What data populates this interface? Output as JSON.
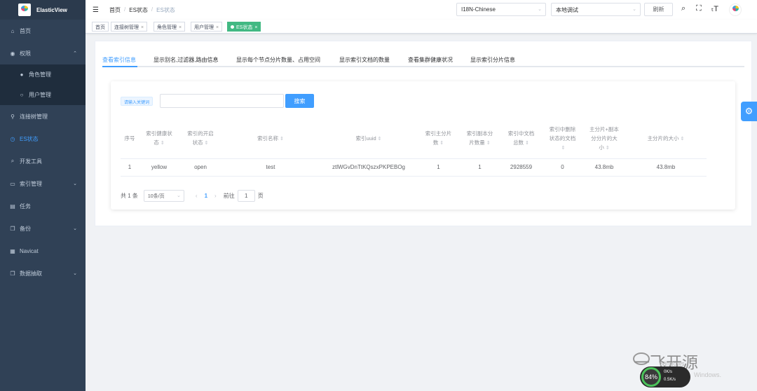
{
  "app": {
    "title": "ElasticView"
  },
  "sidebar": {
    "items": [
      {
        "label": "首页",
        "icon": "home-icon",
        "glyph": "⌂"
      },
      {
        "label": "权限",
        "icon": "user-icon",
        "glyph": "◉",
        "expanded": true
      },
      {
        "label": "角色管理",
        "icon": "user-filled-icon",
        "glyph": "●",
        "sub": true
      },
      {
        "label": "用户管理",
        "icon": "user-outline-icon",
        "glyph": "○",
        "sub": true
      },
      {
        "label": "连接树管理",
        "icon": "link-icon",
        "glyph": "⚲"
      },
      {
        "label": "ES状态",
        "icon": "clock-icon",
        "glyph": "◷",
        "active": true
      },
      {
        "label": "开发工具",
        "icon": "search-icon",
        "glyph": "⌕"
      },
      {
        "label": "索引管理",
        "icon": "disk-icon",
        "glyph": "▭"
      },
      {
        "label": "任务",
        "icon": "document-icon",
        "glyph": "▤"
      },
      {
        "label": "备份",
        "icon": "copy-icon",
        "glyph": "❐"
      },
      {
        "label": "Navicat",
        "icon": "table-icon",
        "glyph": "▦"
      },
      {
        "label": "数据抽取",
        "icon": "copy-icon",
        "glyph": "❐"
      }
    ]
  },
  "header": {
    "breadcrumb": [
      "首页",
      "ES状态",
      "ES状态"
    ],
    "language_select": "I18N-Chinese",
    "env_select": "本地调试",
    "refresh_label": "刷新"
  },
  "tags": [
    "首页",
    "连接树管理",
    "角色管理",
    "用户管理",
    "ES状态"
  ],
  "tabs": [
    "查看索引信息",
    "显示别名,过滤器,路由信息",
    "显示每个节点分片数量、占用空间",
    "显示索引文档的数量",
    "查看集群健康状况",
    "显示索引分片信息"
  ],
  "search": {
    "label": "请输入关键词",
    "value": "",
    "button": "搜索"
  },
  "table": {
    "columns": [
      [
        "序号"
      ],
      [
        "索引健康状",
        "态"
      ],
      [
        "索引的开启",
        "状态"
      ],
      [
        "索引名称"
      ],
      [
        "索引uuid"
      ],
      [
        "索引主分片",
        "数"
      ],
      [
        "索引副本分",
        "片数量"
      ],
      [
        "索引中文档",
        "总数"
      ],
      [
        "索引中删除",
        "状态的文档",
        ""
      ],
      [
        "主分片+副本",
        "分分片的大",
        "小"
      ],
      [
        "主分片的大小"
      ]
    ],
    "rows": [
      [
        "1",
        "yellow",
        "open",
        "test",
        "ztlWGvDnTtKQszxPKPEBOg",
        "1",
        "1",
        "2928559",
        "0",
        "43.8mb",
        "43.8mb"
      ]
    ]
  },
  "pagination": {
    "total": "共 1 条",
    "page_size": "10条/页",
    "current": "1",
    "goto_label": "前往",
    "goto_value": "1",
    "page_suffix": "页"
  },
  "watermark": {
    "text": "一飞开源",
    "windows_line1": "Windows",
    "windows_line2": "Windows."
  },
  "meter": {
    "percent": "84%",
    "up": "0K/s",
    "down": "0.5K/s"
  }
}
